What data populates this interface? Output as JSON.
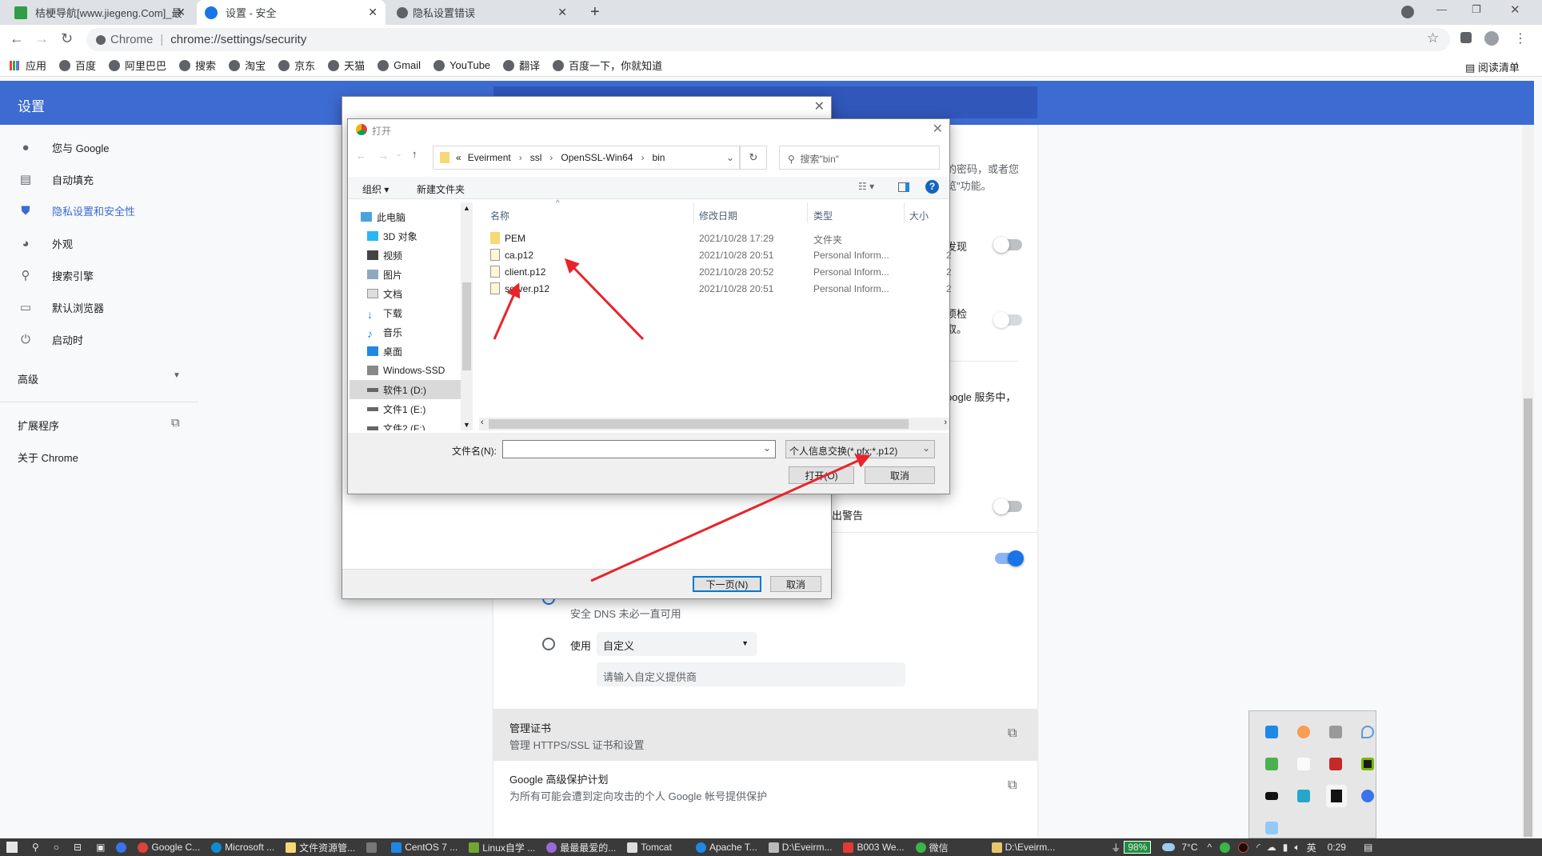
{
  "browser": {
    "tabs": [
      {
        "label": "桔梗导航[www.jiegeng.Com]_最",
        "active": false
      },
      {
        "label": "设置 - 安全",
        "active": true
      },
      {
        "label": "隐私设置错误",
        "active": false
      }
    ],
    "new_tab": "+",
    "omnibox": {
      "scheme_label": "Chrome",
      "url": "chrome://settings/security"
    },
    "bookmarks": [
      "应用",
      "百度",
      "阿里巴巴",
      "搜索",
      "淘宝",
      "京东",
      "天猫",
      "Gmail",
      "YouTube",
      "翻译",
      "百度一下，你就知道"
    ],
    "reading_list": "阅读清单"
  },
  "settings": {
    "title": "设置",
    "sidebar": [
      {
        "label": "您与 Google",
        "icon": "person-icon"
      },
      {
        "label": "自动填充",
        "icon": "clipboard-icon"
      },
      {
        "label": "隐私设置和安全性",
        "icon": "shield-icon",
        "active": true
      },
      {
        "label": "外观",
        "icon": "palette-icon"
      },
      {
        "label": "搜索引擎",
        "icon": "search-icon"
      },
      {
        "label": "默认浏览器",
        "icon": "browser-icon"
      },
      {
        "label": "启动时",
        "icon": "power-icon"
      }
    ],
    "advanced": "高级",
    "extensions": "扩展程序",
    "about": "关于 Chrome",
    "content": {
      "frag1": "的密码，或者您",
      "frag2": "览\"功能。",
      "frag3": "发现",
      "frag4": "项检",
      "frag5": "取。",
      "frag6": "oogle 服务中，",
      "frag7": "出警告",
      "dns_note": "安全 DNS 未必一直可用",
      "use_label": "使用",
      "provider_select": "自定义",
      "provider_placeholder": "请输入自定义提供商",
      "cert_title": "管理证书",
      "cert_sub": "管理 HTTPS/SSL 证书和设置",
      "adv_title": "Google 高级保护计划",
      "adv_sub": "为所有可能会遭到定向攻击的个人 Google 帐号提供保护",
      "toggles": {
        "discover": false,
        "check": false,
        "warn": false,
        "dns": true
      }
    }
  },
  "wizard": {
    "next": "下一页(N)",
    "cancel": "取消"
  },
  "open_dialog": {
    "title": "打开",
    "path": [
      "Eveirment",
      "ssl",
      "OpenSSL-Win64",
      "bin"
    ],
    "search_placeholder": "搜索\"bin\"",
    "organize": "组织 ▾",
    "new_folder": "新建文件夹",
    "tree": [
      "此电脑",
      "3D 对象",
      "视频",
      "图片",
      "文档",
      "下载",
      "音乐",
      "桌面",
      "Windows-SSD",
      "软件1 (D:)",
      "文件1 (E:)",
      "文件2 (F:)"
    ],
    "tree_selected": "软件1 (D:)",
    "columns": [
      "名称",
      "修改日期",
      "类型",
      "大小"
    ],
    "files": [
      {
        "name": "PEM",
        "date": "2021/10/28 17:29",
        "type": "文件夹",
        "size": ""
      },
      {
        "name": "ca.p12",
        "date": "2021/10/28 20:51",
        "type": "Personal Inform...",
        "size": "2"
      },
      {
        "name": "client.p12",
        "date": "2021/10/28 20:52",
        "type": "Personal Inform...",
        "size": "2"
      },
      {
        "name": "server.p12",
        "date": "2021/10/28 20:51",
        "type": "Personal Inform...",
        "size": "2"
      }
    ],
    "filename_label": "文件名(N):",
    "filename_value": "",
    "filter": "个人信息交换(*.pfx;*.p12)",
    "open": "打开(O)",
    "cancel": "取消"
  },
  "taskbar": {
    "apps": [
      "Google C...",
      "Microsoft ...",
      "文件资源管...",
      "",
      "CentOS 7 ...",
      "Linux自学 ...",
      "最最最爱的...",
      "Tomcat",
      "Apache T...",
      "D:\\Eveirm...",
      "B003 We...",
      "微信",
      "D:\\Eveirm..."
    ],
    "battery": "98%",
    "weather": "7°C",
    "ime": "英",
    "time": "0:29"
  },
  "colors": {
    "accent": "#3c6bd2",
    "arrow": "#e8242a"
  }
}
